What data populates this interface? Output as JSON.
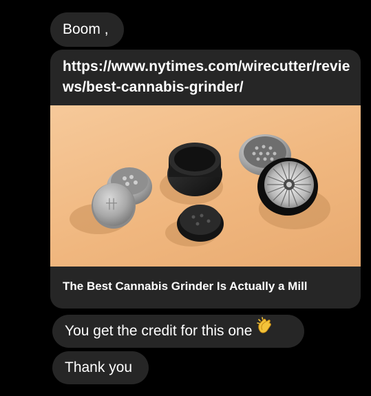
{
  "messages": {
    "first": "Boom ,",
    "link_url": "https://www.nytimes.com/wirecutter/reviews/best-cannabis-grinder/",
    "link_title": "The Best Cannabis Grinder Is Actually a Mill",
    "credit": "You get the credit for this one",
    "credit_emoji": "clapping-hands-icon",
    "thanks": "Thank you"
  },
  "colors": {
    "background": "#000000",
    "bubble": "#262626",
    "text": "#ffffff",
    "image_background": "#f0b77f"
  }
}
